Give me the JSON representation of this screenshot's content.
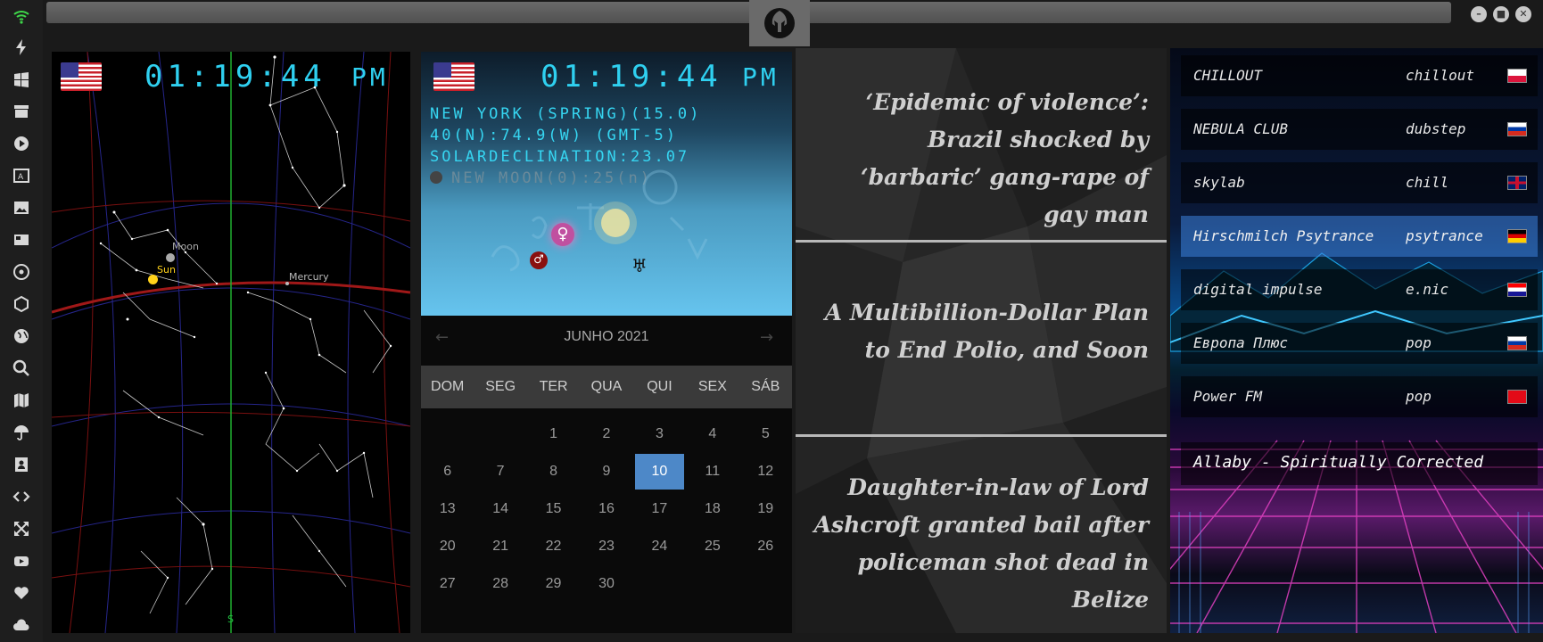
{
  "clock": {
    "time": "01:19:44",
    "ampm": "PM"
  },
  "sky": {
    "labels": {
      "moon": "Moon",
      "sun": "Sun",
      "mercury": "Mercury",
      "south": "S"
    }
  },
  "astro": {
    "location": "NEW YORK (SPRING)(15.0)",
    "coords": "40(N):74.9(W) (GMT-5)",
    "declination": "SOLARDECLINATION:23.07",
    "moon": "NEW MOON(0):25(n)"
  },
  "calendar": {
    "month": "JUNHO 2021",
    "weekdays": [
      "DOM",
      "SEG",
      "TER",
      "QUA",
      "QUI",
      "SEX",
      "SÁB"
    ],
    "today": 10,
    "days": [
      "",
      "",
      "1",
      "2",
      "3",
      "4",
      "5",
      "6",
      "7",
      "8",
      "9",
      "10",
      "11",
      "12",
      "13",
      "14",
      "15",
      "16",
      "17",
      "18",
      "19",
      "20",
      "21",
      "22",
      "23",
      "24",
      "25",
      "26",
      "27",
      "28",
      "29",
      "30"
    ]
  },
  "news": [
    "‘Epidemic of violence’: Brazil shocked by ‘barbaric’ gang-rape of gay man",
    "A Multibillion-Dollar Plan to End Polio, and Soon",
    "Daughter-in-law of Lord Ashcroft granted bail after policeman shot dead in Belize"
  ],
  "radio": {
    "stations": [
      {
        "name": "CHILLOUT",
        "genre": "chillout",
        "flag": "poland"
      },
      {
        "name": "NEBULA CLUB",
        "genre": "dubstep",
        "flag": "russia"
      },
      {
        "name": "skylab",
        "genre": "chill",
        "flag": "uk"
      },
      {
        "name": "Hirschmilch Psytrance",
        "genre": "psytrance",
        "flag": "germany"
      },
      {
        "name": "digital impulse",
        "genre": "e.nic",
        "flag": "croatia"
      },
      {
        "name": "Европа Плюс",
        "genre": "pop",
        "flag": "russia"
      },
      {
        "name": "Power FM",
        "genre": "pop",
        "flag": "turkey"
      }
    ],
    "active_index": 3,
    "now_playing": "Allaby - Spiritually Corrected"
  },
  "colors": {
    "clock": "#2fd0f0",
    "today": "#4d88c8",
    "accent_active": "#3c82dc"
  }
}
